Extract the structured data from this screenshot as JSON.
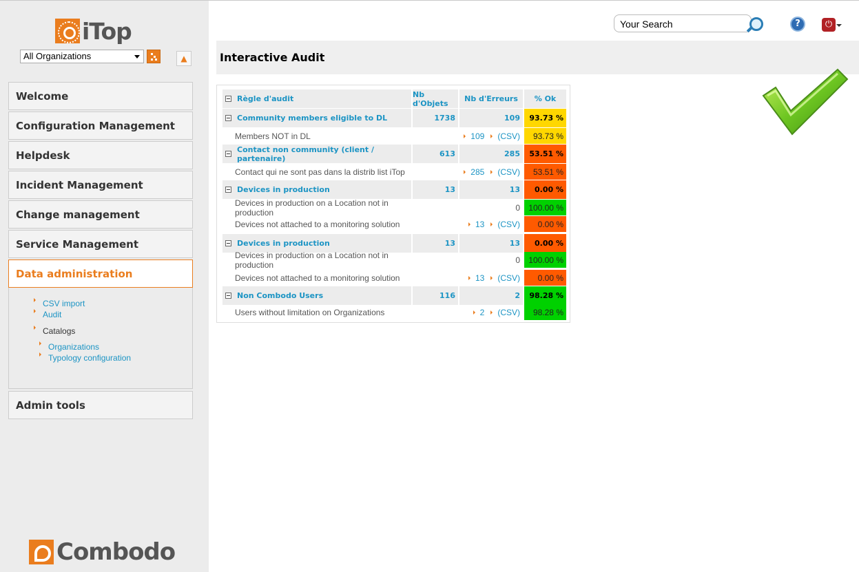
{
  "app": {
    "logo_text": "iTop",
    "footer_logo_text": "Combodo"
  },
  "header": {
    "search_placeholder": "Your Search",
    "help_glyph": "?",
    "power_glyph": "⏻"
  },
  "sidebar": {
    "org_filter": "All Organizations",
    "pin_glyph": "📌",
    "menus": [
      {
        "label": "Welcome",
        "active": false
      },
      {
        "label": "Configuration Management",
        "active": false
      },
      {
        "label": "Helpdesk",
        "active": false
      },
      {
        "label": "Incident Management",
        "active": false
      },
      {
        "label": "Change management",
        "active": false
      },
      {
        "label": "Service Management",
        "active": false
      },
      {
        "label": "Data administration",
        "active": true
      },
      {
        "label": "Admin tools",
        "active": false
      }
    ],
    "submenu": {
      "csv_import": "CSV import",
      "audit": "Audit",
      "catalogs": "Catalogs",
      "organizations": "Organizations",
      "typology": "Typology configuration"
    }
  },
  "page": {
    "title": "Interactive Audit"
  },
  "audit": {
    "columns": {
      "rule": "Règle d'audit",
      "objects": "Nb d'Objets",
      "errors": "Nb d'Erreurs",
      "ok": "% Ok"
    },
    "csv_label": "(CSV)",
    "rows": [
      {
        "type": "category",
        "label": "Community members eligible to DL",
        "objects": "1738",
        "errors": "109",
        "ok": "93.73 %",
        "status": "yellow"
      },
      {
        "type": "rule",
        "label": "Members NOT in DL",
        "errors": "109",
        "ok": "93.73 %",
        "status": "yellow"
      },
      {
        "type": "category",
        "label": "Contact non community (client / partenaire)",
        "objects": "613",
        "errors": "285",
        "ok": "53.51 %",
        "status": "orange"
      },
      {
        "type": "rule",
        "label": "Contact qui ne sont pas dans la distrib list iTop",
        "errors": "285",
        "ok": "53.51 %",
        "status": "orange"
      },
      {
        "type": "category",
        "label": "Devices in production",
        "objects": "13",
        "errors": "13",
        "ok": "0.00 %",
        "status": "orange"
      },
      {
        "type": "rule",
        "label": "Devices in production on a Location not in production",
        "errors": "0",
        "ok": "100.00 %",
        "status": "green"
      },
      {
        "type": "rule",
        "label": "Devices not attached to a monitoring solution",
        "errors": "13",
        "ok": "0.00 %",
        "status": "orange"
      },
      {
        "type": "category",
        "label": "Devices in production",
        "objects": "13",
        "errors": "13",
        "ok": "0.00 %",
        "status": "orange"
      },
      {
        "type": "rule",
        "label": "Devices in production on a Location not in production",
        "errors": "0",
        "ok": "100.00 %",
        "status": "green"
      },
      {
        "type": "rule",
        "label": "Devices not attached to a monitoring solution",
        "errors": "13",
        "ok": "0.00 %",
        "status": "orange"
      },
      {
        "type": "category",
        "label": "Non Combodo Users",
        "objects": "116",
        "errors": "2",
        "ok": "98.28 %",
        "status": "green"
      },
      {
        "type": "rule",
        "label": "Users without limitation on Organizations",
        "errors": "2",
        "ok": "98.28 %",
        "status": "green"
      }
    ]
  },
  "colors": {
    "accent": "#ea7d1e",
    "link": "#1c94c4",
    "yellow": "#ffd700",
    "orange": "#ff5a00",
    "green": "#00d100"
  }
}
